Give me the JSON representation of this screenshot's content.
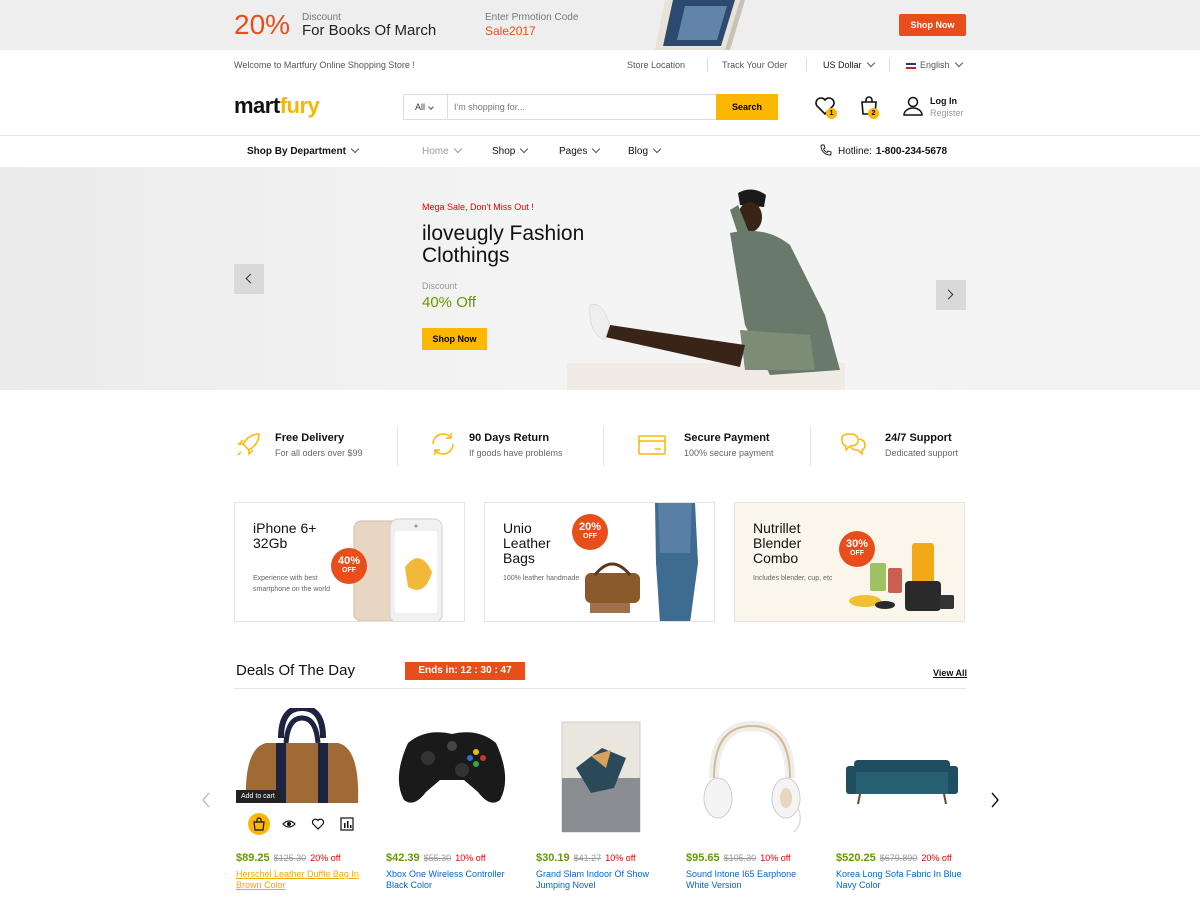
{
  "promo_bar": {
    "percent": "20%",
    "discount_label": "Discount",
    "discount_title": "For Books Of March",
    "code_label": "Enter Prmotion Code",
    "code": "Sale2017",
    "button": "Shop Now"
  },
  "topbar": {
    "welcome": "Welcome to Martfury Online Shopping Store !",
    "store_location": "Store Location",
    "track_order": "Track Your Oder",
    "currency": "US Dollar",
    "language": "English"
  },
  "header": {
    "logo_part1": "mart",
    "logo_part2": "fury",
    "search_category": "All",
    "search_placeholder": "I'm shopping for...",
    "search_button": "Search",
    "wishlist_count": "1",
    "cart_count": "2",
    "login": "Log In",
    "register": "Register"
  },
  "nav": {
    "department": "Shop By Department",
    "items": [
      {
        "label": "Home"
      },
      {
        "label": "Shop"
      },
      {
        "label": "Pages"
      },
      {
        "label": "Blog"
      }
    ],
    "hotline_label": "Hotline:",
    "hotline_number": "1-800-234-5678"
  },
  "hero": {
    "tag": "Mega Sale, Don't Miss Out !",
    "title": "iloveugly Fashion Clothings",
    "discount_label": "Discount",
    "discount_value": "40% Off",
    "button": "Shop Now"
  },
  "features": [
    {
      "title": "Free Delivery",
      "subtitle": "For all oders over $99",
      "icon": "rocket-icon"
    },
    {
      "title": "90 Days Return",
      "subtitle": "If goods have problems",
      "icon": "refresh-icon"
    },
    {
      "title": "Secure Payment",
      "subtitle": "100% secure payment",
      "icon": "credit-card-icon"
    },
    {
      "title": "24/7 Support",
      "subtitle": "Dedicated support",
      "icon": "chat-icon"
    }
  ],
  "promo_cards": [
    {
      "title": "iPhone 6+ 32Gb",
      "subtitle": "Experience with best smartphone on the world",
      "percent": "40%",
      "off": "OFF"
    },
    {
      "title": "Unio Leather Bags",
      "subtitle": "100% leather handmade",
      "percent": "20%",
      "off": "OFF"
    },
    {
      "title": "Nutrillet Blender Combo",
      "subtitle": "Includes blender, cup, etc",
      "percent": "30%",
      "off": "OFF"
    }
  ],
  "deals": {
    "title": "Deals Of The Day",
    "ends_in": "Ends in:  12 : 30 : 47",
    "view_all": "View All",
    "tooltip": "Add to cart",
    "products": [
      {
        "price": "$89.25",
        "old_price": "$125.30",
        "discount": "20% off",
        "name": "Herschel Leather Duffle Bag In Brown Color"
      },
      {
        "price": "$42.39",
        "old_price": "$55.30",
        "discount": "10% off",
        "name": "Xbox One Wireless Controller Black Color"
      },
      {
        "price": "$30.19",
        "old_price": "$41.27",
        "discount": "10% off",
        "name": "Grand Slam Indoor Of Show Jumping Novel"
      },
      {
        "price": "$95.65",
        "old_price": "$105.30",
        "discount": "10% off",
        "name": "Sound Intone I65 Earphone White Version"
      },
      {
        "price": "$520.25",
        "old_price": "$679.890",
        "discount": "20% off",
        "name": "Korea Long Sofa Fabric In Blue Navy Color"
      }
    ]
  },
  "colors": {
    "accent_yellow": "#fcb800",
    "promo_orange": "#e84e1b",
    "price_green": "#669900",
    "link_blue": "#0066cc"
  }
}
